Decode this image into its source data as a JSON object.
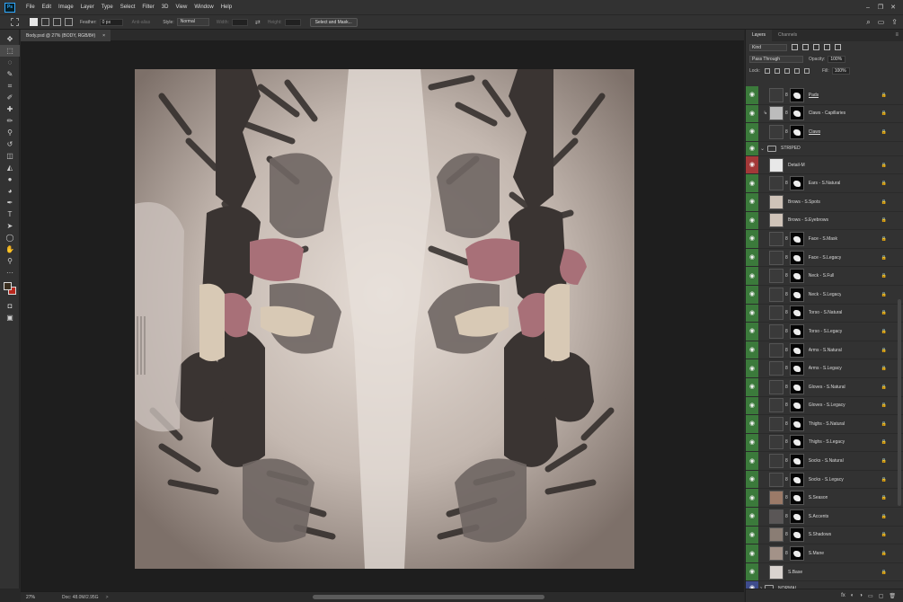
{
  "app": {
    "logo": "Ps"
  },
  "menu": [
    "File",
    "Edit",
    "Image",
    "Layer",
    "Type",
    "Select",
    "Filter",
    "3D",
    "View",
    "Window",
    "Help"
  ],
  "window_controls": {
    "minimize": "–",
    "restore": "❐",
    "close": "✕"
  },
  "options": {
    "feather_label": "Feather:",
    "feather_value": "0 px",
    "antialias_label": "Anti-alias",
    "style_label": "Style:",
    "style_value": "Normal",
    "width_label": "Width:",
    "height_label": "Height:",
    "select_mask_label": "Select and Mask..."
  },
  "tools": [
    "move",
    "marquee",
    "lasso",
    "quick-select",
    "crop",
    "eyedropper",
    "healing",
    "brush",
    "clone-stamp",
    "history-brush",
    "eraser",
    "paint-bucket",
    "blur",
    "dodge",
    "pen",
    "type",
    "path-select",
    "shape",
    "hand",
    "zoom",
    "more"
  ],
  "colors": {
    "foreground": "#3a2e1f",
    "background": "#b9281e",
    "visibility_green": "#3b7a3b",
    "visibility_red": "#a33838",
    "visibility_blue": "#3e4c8c"
  },
  "document": {
    "tab_title": "Body.psd @ 27% (BODY, RGB/8#)",
    "tab_close": "×"
  },
  "status": {
    "zoom": "27%",
    "doc_size": "Doc: 48.0M/2.95G",
    "arrow": ">"
  },
  "panel": {
    "tabs": [
      "Layers",
      "Channels"
    ],
    "filter_kind": "Kind",
    "blend_mode": "Pass Through",
    "opacity_label": "Opacity:",
    "opacity_value": "100%",
    "lock_label": "Lock:",
    "fill_label": "Fill:",
    "fill_value": "100%"
  },
  "layers": [
    {
      "name": "Pads",
      "vis": "green",
      "underline": true,
      "thumb": "#3a3a3a",
      "mask": true
    },
    {
      "name": "Claws - Capillaries",
      "vis": "green",
      "thumb": "#bcbcbc",
      "mask": true,
      "clip": true
    },
    {
      "name": "Claws",
      "vis": "green",
      "underline": true,
      "thumb": "#3a3a3a",
      "mask": true
    },
    {
      "name": "STRIPED",
      "vis": "green",
      "group": true
    },
    {
      "name": "Detail-M",
      "vis": "red",
      "thumb": "#e8e8e8",
      "mask": false
    },
    {
      "name": "Ears - S.Natural",
      "vis": "green",
      "thumb": "#3a3a3a",
      "mask": true
    },
    {
      "name": "Brows - S.Spots",
      "vis": "green",
      "thumb": "#cfc3b8",
      "mask": false
    },
    {
      "name": "Brows - S.Eyebrows",
      "vis": "green",
      "thumb": "#cfc3b8",
      "mask": false
    },
    {
      "name": "Face - S.Mask",
      "vis": "green",
      "thumb": "#3a3a3a",
      "mask": true
    },
    {
      "name": "Face - S.Legacy",
      "vis": "green",
      "thumb": "#3a3a3a",
      "mask": true
    },
    {
      "name": "Neck - S.Full",
      "vis": "green",
      "thumb": "#3a3a3a",
      "mask": true
    },
    {
      "name": "Neck - S.Legacy",
      "vis": "green",
      "thumb": "#3a3a3a",
      "mask": true
    },
    {
      "name": "Torso - S.Natural",
      "vis": "green",
      "thumb": "#3a3a3a",
      "mask": true
    },
    {
      "name": "Torso - S.Legacy",
      "vis": "green",
      "thumb": "#3a3a3a",
      "mask": true
    },
    {
      "name": "Arms - S.Natural",
      "vis": "green",
      "thumb": "#3a3a3a",
      "mask": true
    },
    {
      "name": "Arms - S.Legacy",
      "vis": "green",
      "thumb": "#3a3a3a",
      "mask": true
    },
    {
      "name": "Gloves - S.Natural",
      "vis": "green",
      "thumb": "#3a3a3a",
      "mask": true
    },
    {
      "name": "Gloves - S.Legacy",
      "vis": "green",
      "thumb": "#3a3a3a",
      "mask": true
    },
    {
      "name": "Thighs - S.Natural",
      "vis": "green",
      "thumb": "#3a3a3a",
      "mask": true
    },
    {
      "name": "Thighs - S.Legacy",
      "vis": "green",
      "thumb": "#3a3a3a",
      "mask": true
    },
    {
      "name": "Socks - S.Natural",
      "vis": "green",
      "thumb": "#3a3a3a",
      "mask": true
    },
    {
      "name": "Socks - S.Legacy",
      "vis": "green",
      "thumb": "#3a3a3a",
      "mask": true
    },
    {
      "name": "S.Season",
      "vis": "green",
      "thumb": "#9b7a68",
      "mask": true
    },
    {
      "name": "S.Accents",
      "vis": "green",
      "thumb": "#5a5656",
      "mask": true
    },
    {
      "name": "S.Shadows",
      "vis": "green",
      "thumb": "#8a7d74",
      "mask": true
    },
    {
      "name": "S.Mane",
      "vis": "green",
      "thumb": "#a39288",
      "mask": true
    },
    {
      "name": "S.Base",
      "vis": "green",
      "thumb": "#d9d3cf",
      "mask": false
    },
    {
      "name": "NORMAL",
      "vis": "blue",
      "group": true,
      "collapsed": true
    }
  ],
  "footer_icons": [
    "fx",
    "◐",
    "◑",
    "▭",
    "▢",
    "🗑"
  ]
}
